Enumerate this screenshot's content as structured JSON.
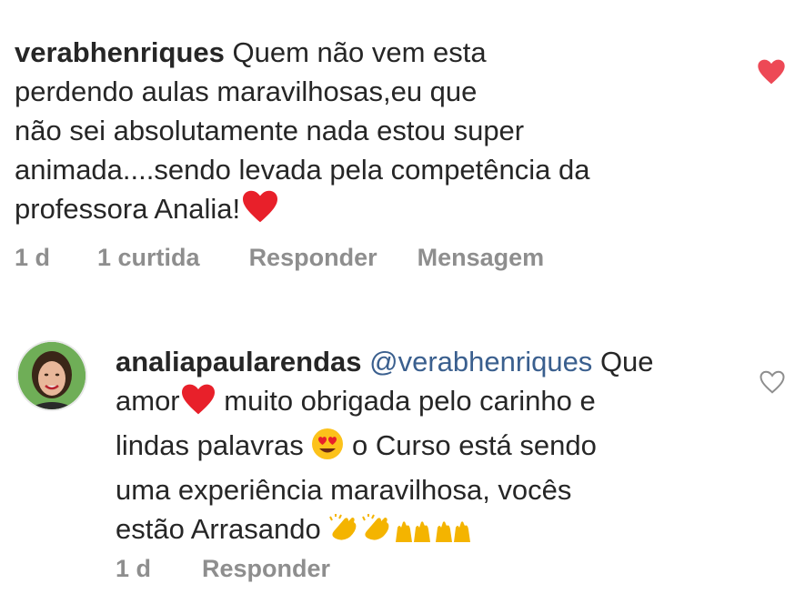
{
  "comments": [
    {
      "username": "verabhenriques",
      "lines": [
        "Quem não vem esta",
        "perdendo aulas maravilhosas,eu que",
        "não sei absolutamente nada estou super",
        "animada....sendo levada pela competência da",
        "professora Analia!"
      ],
      "time": "1 d",
      "likes": "1 curtida",
      "reply_label": "Responder",
      "message_label": "Mensagem",
      "liked": true
    },
    {
      "username": "analiapaularendas",
      "mention": "@verabhenriques",
      "lines": [
        "Que",
        "amor",
        "muito obrigada pelo carinho e",
        "lindas palavras",
        "o Curso está sendo",
        "uma experiência maravilhosa, vocês",
        "estão Arrasando"
      ],
      "time": "1 d",
      "reply_label": "Responder",
      "liked": false
    }
  ],
  "colors": {
    "text": "#262626",
    "meta": "#8e8e8e",
    "mention": "#3a5f8e",
    "heart": "#ed4956"
  },
  "icons": {
    "like_filled": "heart-filled-icon",
    "like_outline": "heart-outline-icon",
    "emoji_heart": "red-heart-emoji",
    "emoji_heart_eyes": "heart-eyes-emoji",
    "emoji_clap": "clapping-hands-emoji",
    "emoji_raise": "raising-hands-emoji"
  }
}
